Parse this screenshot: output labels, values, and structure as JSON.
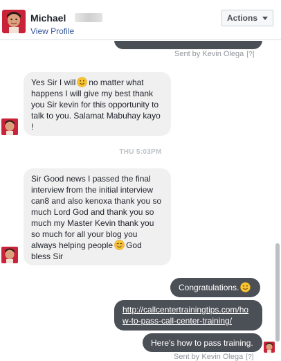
{
  "header": {
    "contact_name": "Michael",
    "view_profile": "View Profile",
    "actions_label": "Actions"
  },
  "thread": {
    "sent_by_top": "Sent by Kevin Olega",
    "sent_by_bottom": "Sent by Kevin Olega",
    "help_marker": "[?]",
    "msg1": {
      "line1a": "Yes Sir I will",
      "line1b": "no matter what",
      "line2": "happens I will give my best thank",
      "line3": "you Sir kevin for this opportunity to",
      "line4": "talk to you. Salamat Mabuhay kayo",
      "line5": "!"
    },
    "timestamp": "THU 5:03PM",
    "msg2": {
      "line1": "Sir Good news I passed the final",
      "line2": "interview from the initial interview",
      "line3": "can8 and also kenoxa thank you so",
      "line4": "much Lord God and thank you so",
      "line5": "much my Master Kevin thank you",
      "line6": "so much for all your blog you",
      "line7a": "always helping people",
      "line7b": "God",
      "line8": "bless Sir"
    },
    "out1": "Congratulations.",
    "out2_line1": "http://callcentertrainingtips.com/ho",
    "out2_line2": "w-to-pass-call-center-training/",
    "out3": "Here's how to pass training."
  },
  "colors": {
    "incoming_bubble": "#f1f0f0",
    "outgoing_bubble": "#4b4f56",
    "link": "#365899",
    "meta_text": "#90949c"
  },
  "icons": [
    "avatar",
    "caret-down-icon",
    "smiley-emoji-icon",
    "blush-emoji-icon",
    "help-icon"
  ]
}
